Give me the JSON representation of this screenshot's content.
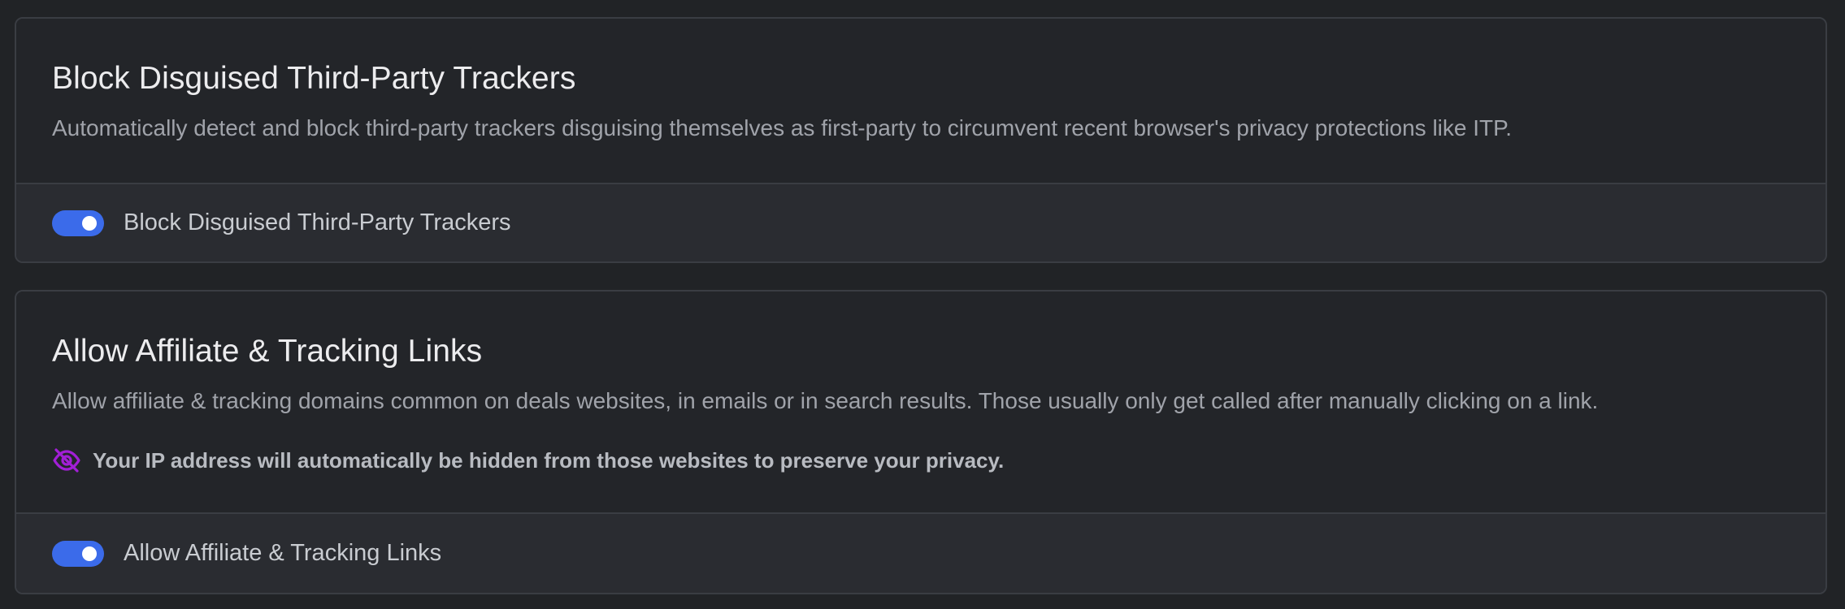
{
  "sections": [
    {
      "title": "Block Disguised Third-Party Trackers",
      "description": "Automatically detect and block third-party trackers disguising themselves as first-party to circumvent recent browser's privacy protections like ITP.",
      "toggle": {
        "label": "Block Disguised Third-Party Trackers",
        "checked": true
      }
    },
    {
      "title": "Allow Affiliate & Tracking Links",
      "description": "Allow affiliate & tracking domains common on deals websites, in emails or in search results. Those usually only get called after manually clicking on a link.",
      "note": {
        "icon": "eye-slash-icon",
        "text": "Your IP address will automatically be hidden from those websites to preserve your privacy."
      },
      "toggle": {
        "label": "Allow Affiliate & Tracking Links",
        "checked": true
      }
    }
  ],
  "colors": {
    "background": "#212326",
    "toggle_on": "#3b6bea",
    "note_icon": "#a21fd6",
    "title_text": "#ececee",
    "description_text": "#a0a3aa"
  }
}
